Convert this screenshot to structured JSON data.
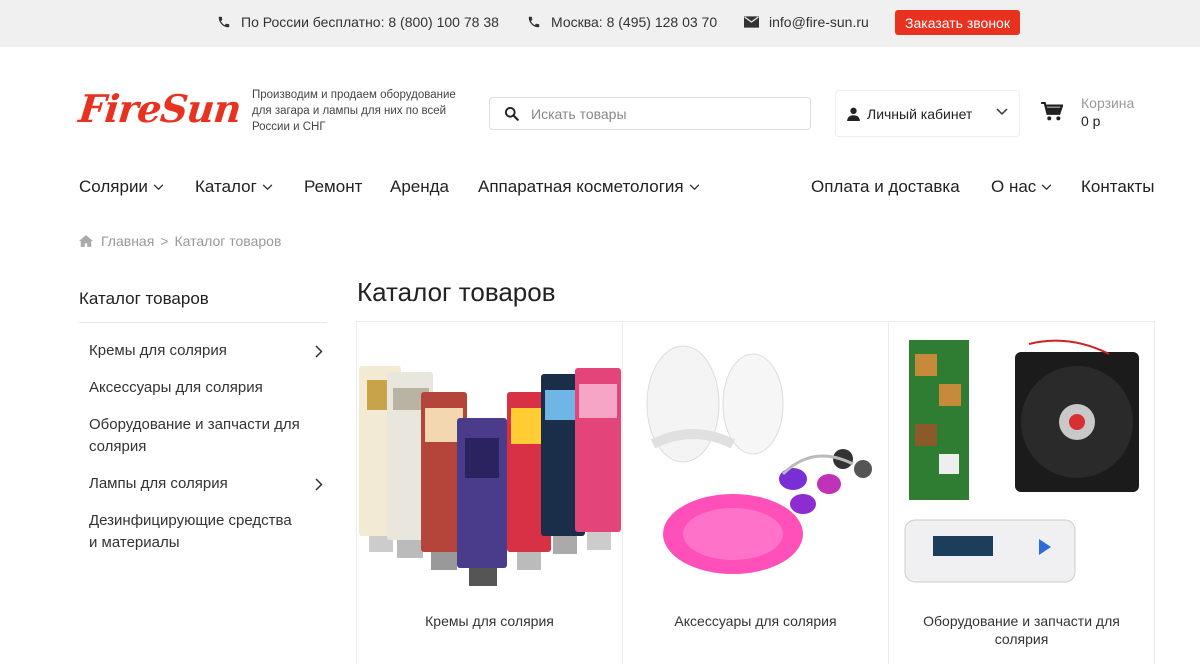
{
  "topbar": {
    "phone_russia": "По России бесплатно: 8 (800) 100 78 38",
    "phone_moscow": "Москва: 8 (495) 128 03 70",
    "email": "info@fire-sun.ru",
    "callback_label": "Заказать звонок",
    "accent_color": "#e8321f"
  },
  "header": {
    "logo_text": "FireSun",
    "tagline": "Производим и продаем оборудование для загара и лампы для них по всей России и СНГ",
    "search_placeholder": "Искать товары",
    "account_label": "Личный кабинет",
    "cart_title": "Корзина",
    "cart_sum": "0 р"
  },
  "nav": {
    "left": [
      "Солярии",
      "Каталог",
      "Ремонт",
      "Аренда",
      "Аппаратная косметология"
    ],
    "right": [
      "Оплата и доставка",
      "О нас",
      "Контакты"
    ]
  },
  "breadcrumb": {
    "home": "Главная",
    "current": "Каталог товаров"
  },
  "sidebar": {
    "title": "Каталог товаров",
    "items": [
      {
        "label": "Кремы для солярия",
        "has_children": true
      },
      {
        "label": "Аксессуары для солярия",
        "has_children": false
      },
      {
        "label": "Оборудование и запчасти для солярия",
        "has_children": false
      },
      {
        "label": "Лампы для солярия",
        "has_children": true
      },
      {
        "label": "Дезинфицирующие средства и материалы",
        "has_children": false
      }
    ]
  },
  "main": {
    "title": "Каталог товаров",
    "cards": [
      {
        "label": "Кремы для солярия",
        "image": "tanning-creams-tubes"
      },
      {
        "label": "Аксессуары для солярия",
        "image": "slippers-goggles-caps"
      },
      {
        "label": "Оборудование и запчасти для солярия",
        "image": "circuit-board-fan-controller"
      }
    ]
  }
}
